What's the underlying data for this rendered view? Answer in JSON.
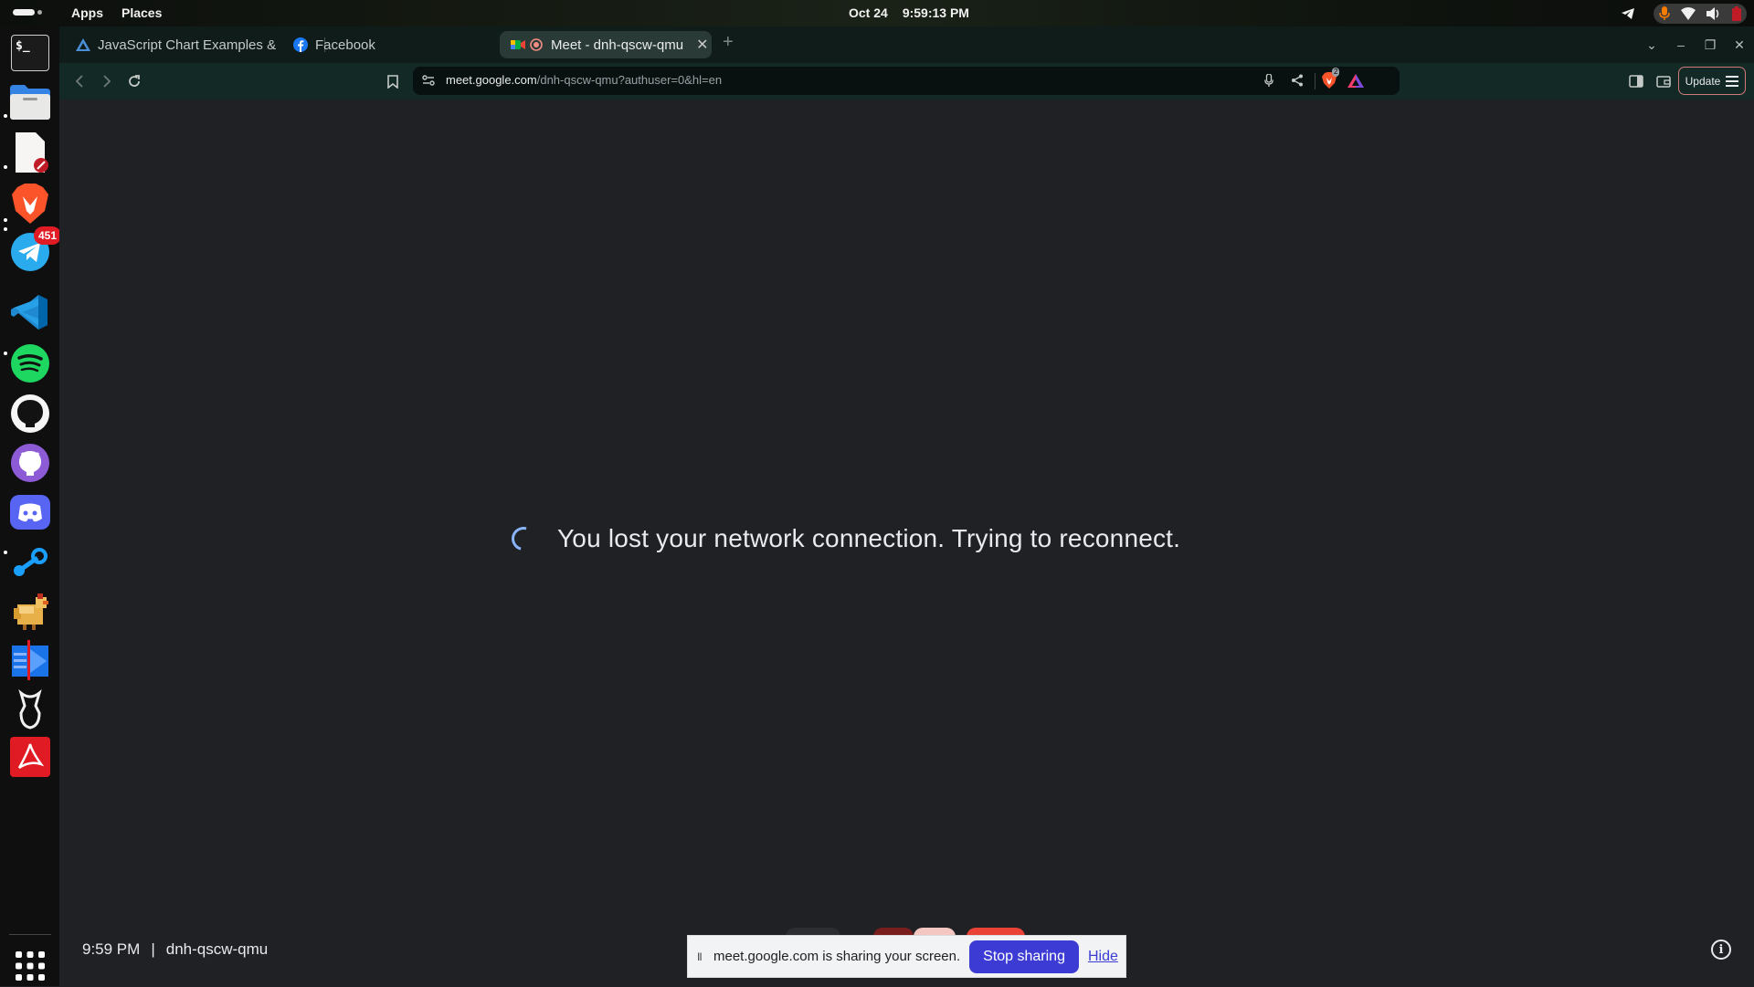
{
  "topbar": {
    "apps": "Apps",
    "places": "Places",
    "date": "Oct 24",
    "time": "9:59:13 PM"
  },
  "dock": {
    "telegram_badge": "451",
    "terminal_glyph": "$_"
  },
  "tabs": [
    {
      "title": "JavaScript Chart Examples &",
      "active": false
    },
    {
      "title": "Facebook",
      "active": false
    },
    {
      "title": "Meet - dnh-qscw-qmu",
      "active": true
    }
  ],
  "omnibox": {
    "domain": "meet.google.com",
    "path": "/dnh-qscw-qmu?authuser=0&hl=en",
    "shield_count": "2"
  },
  "toolbar": {
    "update_label": "Update"
  },
  "meet": {
    "reconnect_message": "You lost your network connection. Trying to reconnect.",
    "meeting_time": "9:59 PM",
    "separator": "|",
    "meeting_code": "dnh-qscw-qmu"
  },
  "share_bar": {
    "pause_glyph": "II",
    "message": "meet.google.com is sharing your screen.",
    "stop_label": "Stop sharing",
    "hide_label": "Hide"
  },
  "colors": {
    "accent": "#8ab4f8",
    "stop_sharing": "#3c3cd4",
    "badge": "#e01b24"
  }
}
